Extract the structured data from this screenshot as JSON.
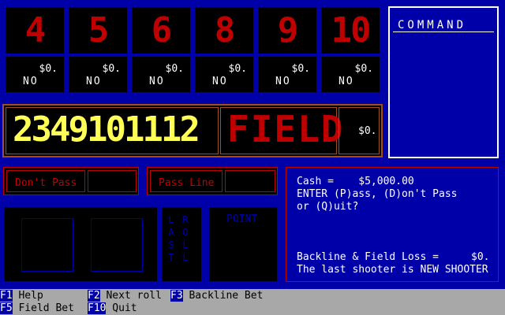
{
  "numbers": [
    {
      "label": "4",
      "bet": "$0.",
      "status": "NO"
    },
    {
      "label": "5",
      "bet": "$0.",
      "status": "NO"
    },
    {
      "label": "6",
      "bet": "$0.",
      "status": "NO"
    },
    {
      "label": "8",
      "bet": "$0.",
      "status": "NO"
    },
    {
      "label": "9",
      "bet": "$0.",
      "status": "NO"
    },
    {
      "label": "10",
      "bet": "$0.",
      "status": "NO"
    }
  ],
  "command": {
    "title": "COMMAND"
  },
  "field": {
    "numbers_text": "2349101112",
    "word": "FIELD",
    "bet": "$0."
  },
  "dont_pass": {
    "label": "Don't Pass"
  },
  "pass_line": {
    "label": "Pass Line"
  },
  "last_roll": {
    "letters_left": [
      "L",
      "A",
      "S",
      "T"
    ],
    "letters_right": [
      "R",
      "O",
      "L",
      "L"
    ]
  },
  "point": {
    "label": "POINT"
  },
  "info": {
    "cash_label": "Cash =",
    "cash_value": "$5,000.00",
    "prompt_line1": "ENTER (P)ass, (D)on't Pass",
    "prompt_line2": "or (Q)uit?",
    "backline_label": "Backline & Field Loss =",
    "backline_value": "$0.",
    "shooter_line": "The last shooter is NEW SHOOTER"
  },
  "fkeys": [
    {
      "key": "F1",
      "label": " Help"
    },
    {
      "key": "F2",
      "label": " Next roll"
    },
    {
      "key": "F3",
      "label": " Backline Bet"
    },
    {
      "key": "F5",
      "label": " Field Bet"
    },
    {
      "key": "F10",
      "label": " Quit"
    }
  ],
  "colors": {
    "background": "#0000a8",
    "number_red": "#c00000",
    "field_yellow": "#ffff55",
    "fkey_bar": "#a8a8a8"
  }
}
